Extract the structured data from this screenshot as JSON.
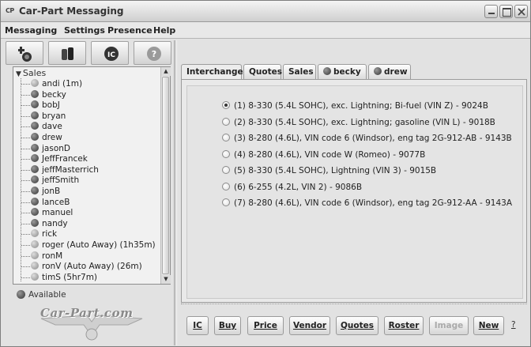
{
  "window": {
    "icon_text": "CP",
    "title": "Car-Part Messaging"
  },
  "menu": {
    "messaging": "Messaging",
    "settings": "Settings",
    "presence": "Presence",
    "help": "Help"
  },
  "toolbar": {
    "icons": [
      "add-contact-icon",
      "group-icon",
      "ic-icon",
      "help-icon"
    ],
    "ic_label": "IC",
    "help_label": "?"
  },
  "contacts": {
    "group": "Sales",
    "items": [
      {
        "label": "andi (1m)",
        "status": "away"
      },
      {
        "label": "becky",
        "status": "online"
      },
      {
        "label": "bobJ",
        "status": "online"
      },
      {
        "label": "bryan",
        "status": "online"
      },
      {
        "label": "dave",
        "status": "online"
      },
      {
        "label": "drew",
        "status": "online"
      },
      {
        "label": "jasonD",
        "status": "online"
      },
      {
        "label": "JeffFrancek",
        "status": "online"
      },
      {
        "label": "jeffMasterrich",
        "status": "online"
      },
      {
        "label": "jeffSmith",
        "status": "online"
      },
      {
        "label": "jonB",
        "status": "online"
      },
      {
        "label": "lanceB",
        "status": "online"
      },
      {
        "label": "manuel",
        "status": "online"
      },
      {
        "label": "nandy",
        "status": "online"
      },
      {
        "label": "rick",
        "status": "away"
      },
      {
        "label": "roger (Auto Away) (1h35m)",
        "status": "away"
      },
      {
        "label": "ronM",
        "status": "away"
      },
      {
        "label": "ronV (Auto Away) (26m)",
        "status": "away"
      },
      {
        "label": "timS (5hr7m)",
        "status": "away"
      }
    ]
  },
  "status": {
    "label": "Available"
  },
  "logo": {
    "text": "Car-Part.com"
  },
  "tabs": [
    {
      "label": "Interchange",
      "active": true,
      "has_status": false
    },
    {
      "label": "Quotes",
      "active": false,
      "has_status": false
    },
    {
      "label": "Sales",
      "active": false,
      "has_status": false
    },
    {
      "label": "becky",
      "active": false,
      "has_status": true
    },
    {
      "label": "drew",
      "active": false,
      "has_status": true
    }
  ],
  "options": [
    {
      "label": "(1) 8-330 (5.4L SOHC), exc. Lightning; Bi-fuel (VIN Z) - 9024B",
      "checked": true
    },
    {
      "label": "(2) 8-330 (5.4L SOHC), exc. Lightning; gasoline (VIN L) - 9018B",
      "checked": false
    },
    {
      "label": "(3) 8-280 (4.6L), VIN code 6 (Windsor), eng tag 2G-912-AB - 9143B",
      "checked": false
    },
    {
      "label": "(4) 8-280 (4.6L), VIN code W (Romeo) - 9077B",
      "checked": false
    },
    {
      "label": "(5) 8-330 (5.4L SOHC), Lightning (VIN 3) - 9015B",
      "checked": false
    },
    {
      "label": "(6) 6-255 (4.2L, VIN 2) - 9086B",
      "checked": false
    },
    {
      "label": "(7) 8-280 (4.6L), VIN code 6 (Windsor), eng tag 2G-912-AA - 9143A",
      "checked": false
    }
  ],
  "actions": {
    "ic": "IC",
    "buy": "Buy",
    "price": "Price",
    "vendor": "Vendor",
    "quotes": "Quotes",
    "roster": "Roster",
    "image": "Image",
    "new": "New",
    "help": "?"
  }
}
